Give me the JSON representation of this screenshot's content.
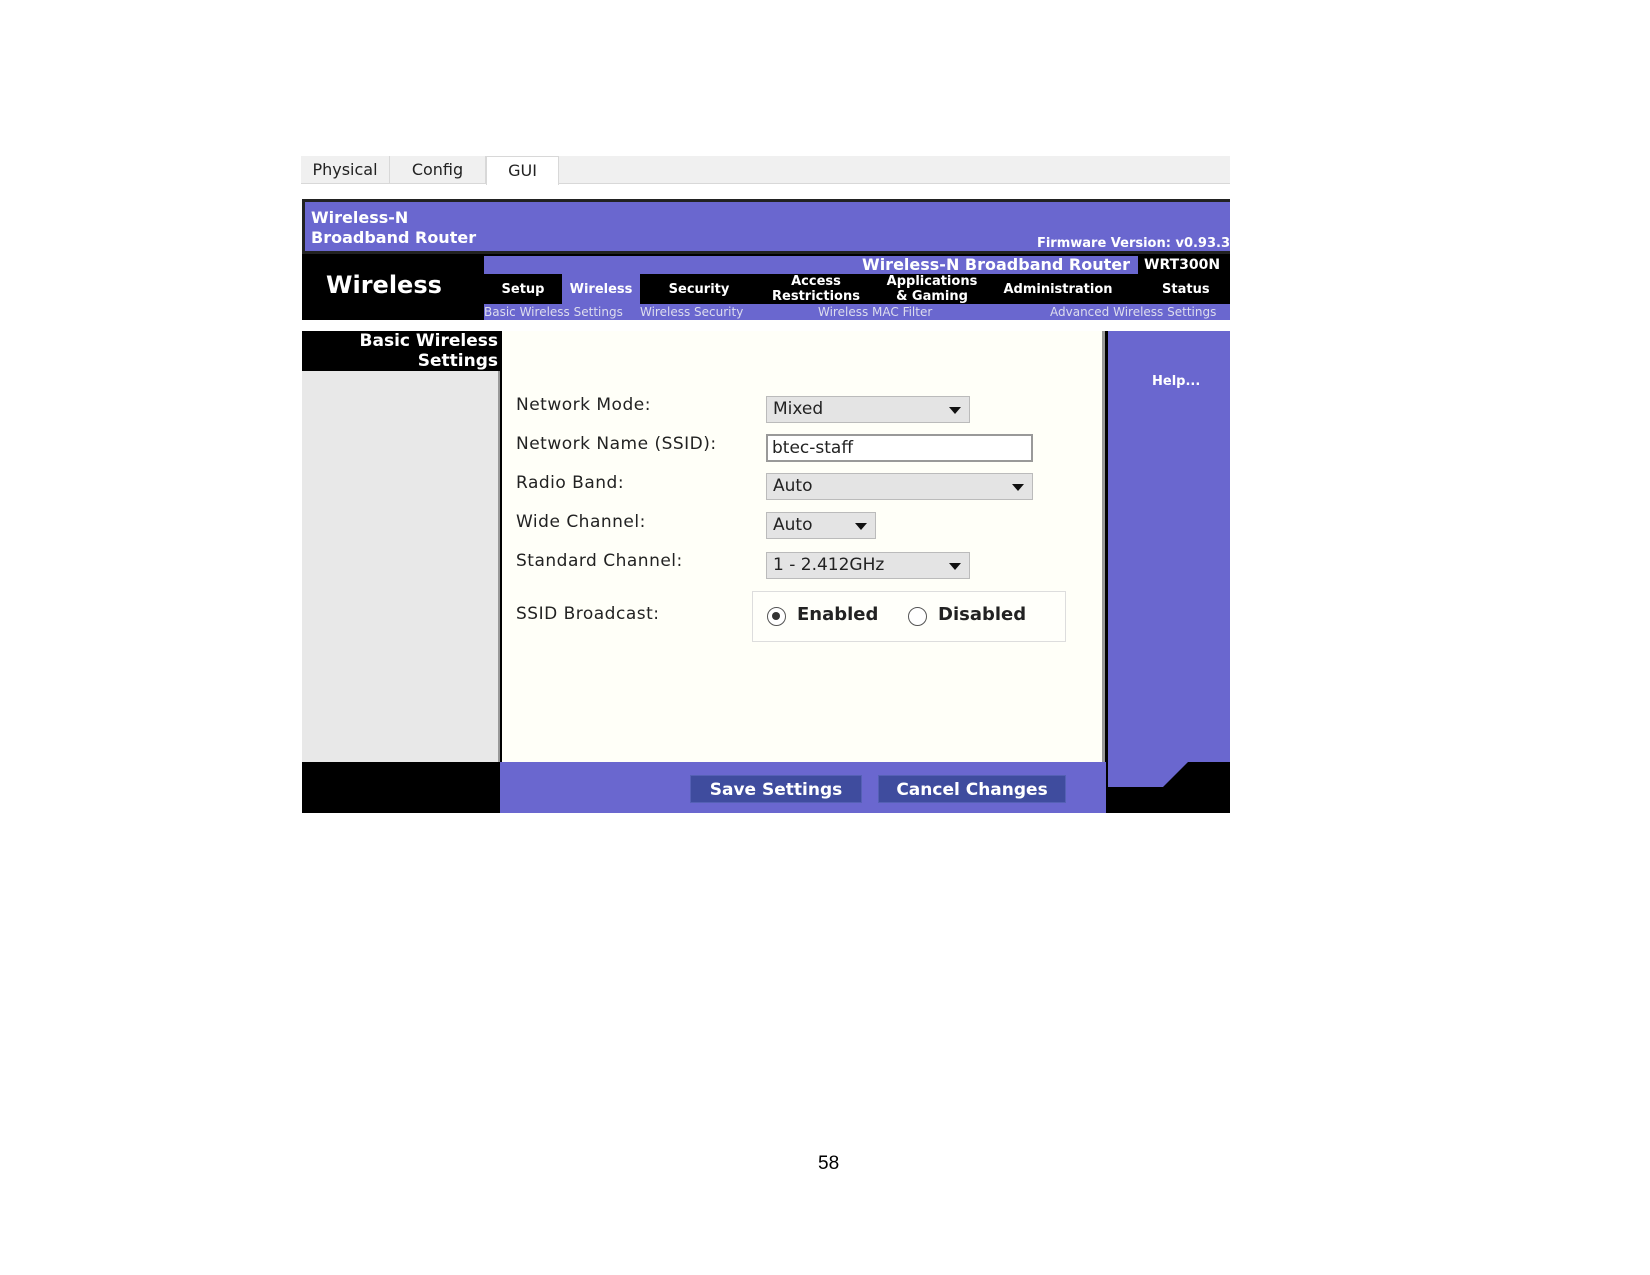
{
  "tabs": [
    "Physical",
    "Config",
    "GUI"
  ],
  "active_tab": "GUI",
  "router": {
    "header_title_line1": "Wireless-N",
    "header_title_line2": "Broadband Router",
    "firmware": "Firmware Version: v0.93.3",
    "section": "Wireless",
    "product_title": "Wireless-N Broadband Router",
    "model": "WRT300N",
    "menu": [
      {
        "label": "Setup"
      },
      {
        "label": "Wireless",
        "active": true
      },
      {
        "label": "Security"
      },
      {
        "label_line1": "Access",
        "label_line2": "Restrictions"
      },
      {
        "label_line1": "Applications",
        "label_line2": "& Gaming"
      },
      {
        "label": "Administration"
      },
      {
        "label": "Status"
      }
    ],
    "submenu": [
      "Basic Wireless Settings",
      "Wireless Security",
      "Wireless MAC Filter",
      "Advanced Wireless Settings"
    ],
    "side_title_line1": "Basic Wireless",
    "side_title_line2": "Settings",
    "help": "Help...",
    "form": {
      "network_mode": {
        "label": "Network Mode:",
        "value": "Mixed"
      },
      "ssid": {
        "label": "Network Name (SSID):",
        "value": "btec-staff"
      },
      "radio_band": {
        "label": "Radio Band:",
        "value": "Auto"
      },
      "wide_channel": {
        "label": "Wide Channel:",
        "value": "Auto"
      },
      "standard_channel": {
        "label": "Standard Channel:",
        "value": "1 - 2.412GHz"
      },
      "ssid_broadcast": {
        "label": "SSID Broadcast:",
        "options": [
          "Enabled",
          "Disabled"
        ],
        "selected": "Enabled"
      }
    },
    "save": "Save Settings",
    "cancel": "Cancel Changes"
  },
  "page_number": "58",
  "colors": {
    "accent": "#6a67cf",
    "button": "#3f4c9e"
  }
}
